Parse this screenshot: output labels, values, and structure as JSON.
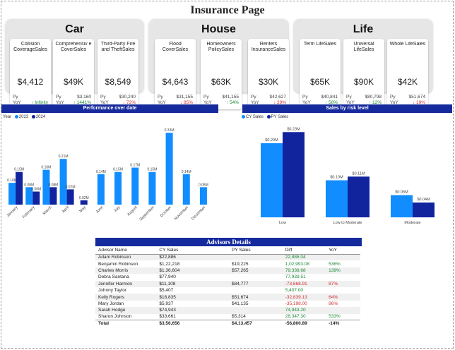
{
  "page_title": "Insurance Page",
  "groups": [
    {
      "title": "Car",
      "cards": [
        {
          "label": "Collision CoverageSales",
          "value": "$4,412",
          "py_label": "Py",
          "py": "",
          "yoy_label": "YoY",
          "yoy": "Infinity",
          "dir": "up"
        },
        {
          "label": "Comprehensiv e CoverSales",
          "value": "$49K",
          "py_label": "Py",
          "py": "$3,160",
          "yoy_label": "YoY",
          "yoy": "1441%",
          "dir": "up"
        },
        {
          "label": "Third-Party Fire and TheftSales",
          "value": "$8,549",
          "py_label": "Py",
          "py": "$30,240",
          "yoy_label": "YoY",
          "yoy": "72%",
          "dir": "down"
        }
      ]
    },
    {
      "title": "House",
      "cards": [
        {
          "label": "Flood CoverSales",
          "value": "$4,643",
          "py_label": "Py",
          "py": "$31,155",
          "yoy_label": "YoY",
          "yoy": "85%",
          "dir": "down"
        },
        {
          "label": "Homeowners PolicySales",
          "value": "$63K",
          "py_label": "Py",
          "py": "$41,155",
          "yoy_label": "YoY",
          "yoy": "54%",
          "dir": "up"
        },
        {
          "label": "Renters InsuranceSales",
          "value": "$30K",
          "py_label": "Py",
          "py": "$42,627",
          "yoy_label": "YoY",
          "yoy": "29%",
          "dir": "down"
        }
      ]
    },
    {
      "title": "Life",
      "cards": [
        {
          "label": "Term LifeSales",
          "value": "$65K",
          "py_label": "Py",
          "py": "$40,841",
          "yoy_label": "YoY",
          "yoy": "58%",
          "dir": "up"
        },
        {
          "label": "Universal LifeSales",
          "value": "$90K",
          "py_label": "Py",
          "py": "$80,798",
          "yoy_label": "YoY",
          "yoy": "12%",
          "dir": "up"
        },
        {
          "label": "Whole LifeSales",
          "value": "$42K",
          "py_label": "Py",
          "py": "$51,674",
          "yoy_label": "YoY",
          "yoy": "19%",
          "dir": "down"
        }
      ]
    }
  ],
  "colors": {
    "current": "#118dff",
    "previous": "#12239e",
    "header": "#152a9c",
    "up": "#1a8a33",
    "down": "#d03030"
  },
  "chart_data": [
    {
      "type": "bar",
      "title": "Performance over date",
      "legend_title": "Year",
      "categories": [
        "January",
        "February",
        "March",
        "April",
        "May",
        "June",
        "July",
        "August",
        "September",
        "October",
        "November",
        "December"
      ],
      "series": [
        {
          "name": "2023",
          "values": [
            0.1,
            0.08,
            0.16,
            0.21,
            null,
            0.14,
            0.15,
            0.17,
            0.15,
            0.33,
            0.14,
            0.08
          ]
        },
        {
          "name": "2024",
          "values": [
            0.15,
            0.06,
            0.08,
            0.07,
            0.02,
            null,
            null,
            null,
            null,
            null,
            null,
            null
          ]
        }
      ],
      "label_texts": {
        "2023": [
          "0.10M",
          "0.08M",
          "0.16M",
          "0.21M",
          "",
          "0.14M",
          "0.15M",
          "0.17M",
          "0.15M",
          "0.33M",
          "0.14M",
          "0.08M"
        ],
        "2024": [
          "0.15M",
          "0.06M",
          "0.08M",
          "0.07M",
          "0.02M",
          "",
          "",
          "",
          "",
          "",
          "",
          ""
        ]
      },
      "ylim": [
        0,
        0.35
      ]
    },
    {
      "type": "bar",
      "title": "Sales by risk level",
      "categories": [
        "Low",
        "Low to Moderate",
        "Moderate"
      ],
      "series": [
        {
          "name": "CY Sales",
          "values": [
            0.2,
            0.1,
            0.06
          ]
        },
        {
          "name": "PY Sales",
          "values": [
            0.23,
            0.11,
            0.04
          ]
        }
      ],
      "label_texts": {
        "CY Sales": [
          "$0.20M",
          "$0.10M",
          "$0.06M"
        ],
        "PY Sales": [
          "$0.23M",
          "$0.11M",
          "$0.04M"
        ]
      },
      "ylim": [
        0,
        0.24
      ]
    }
  ],
  "advisors": {
    "title": "Advisors Details",
    "columns": [
      "Advisor Name",
      "CY Sales",
      "PY Sales",
      "Diff",
      "YoY"
    ],
    "rows": [
      [
        "Adam Robinson",
        "$22,886",
        "",
        "22,886.04",
        ""
      ],
      [
        "Benjamin Robinson",
        "$1,22,218",
        "$19,225",
        "1,02,993.08",
        "536%"
      ],
      [
        "Charles Morris",
        "$1,36,604",
        "$57,265",
        "79,338.68",
        "139%"
      ],
      [
        "Debra Santana",
        "$77,940",
        "",
        "77,939.51",
        ""
      ],
      [
        "Jennifer Harmon",
        "$11,108",
        "$84,777",
        "-73,668.91",
        "87%"
      ],
      [
        "Johnny Taylor",
        "$5,407",
        "",
        "5,407.00",
        ""
      ],
      [
        "Kelly Rogers",
        "$18,835",
        "$51,674",
        "-32,839.13",
        "64%"
      ],
      [
        "Mary Jordan",
        "$5,937",
        "$41,135",
        "-35,198.00",
        "86%"
      ],
      [
        "Sarah Hodge",
        "$74,943",
        "",
        "74,943.20",
        ""
      ],
      [
        "Sharon Johnson",
        "$33,661",
        "$5,314",
        "28,347.30",
        "533%"
      ]
    ],
    "row_dirs": [
      "up",
      "up",
      "up",
      "up",
      "down",
      "up",
      "down",
      "down",
      "up",
      "up"
    ],
    "total": [
      "Total",
      "$3,56,656",
      "$4,13,457",
      "-56,800.89",
      "-14%"
    ]
  }
}
